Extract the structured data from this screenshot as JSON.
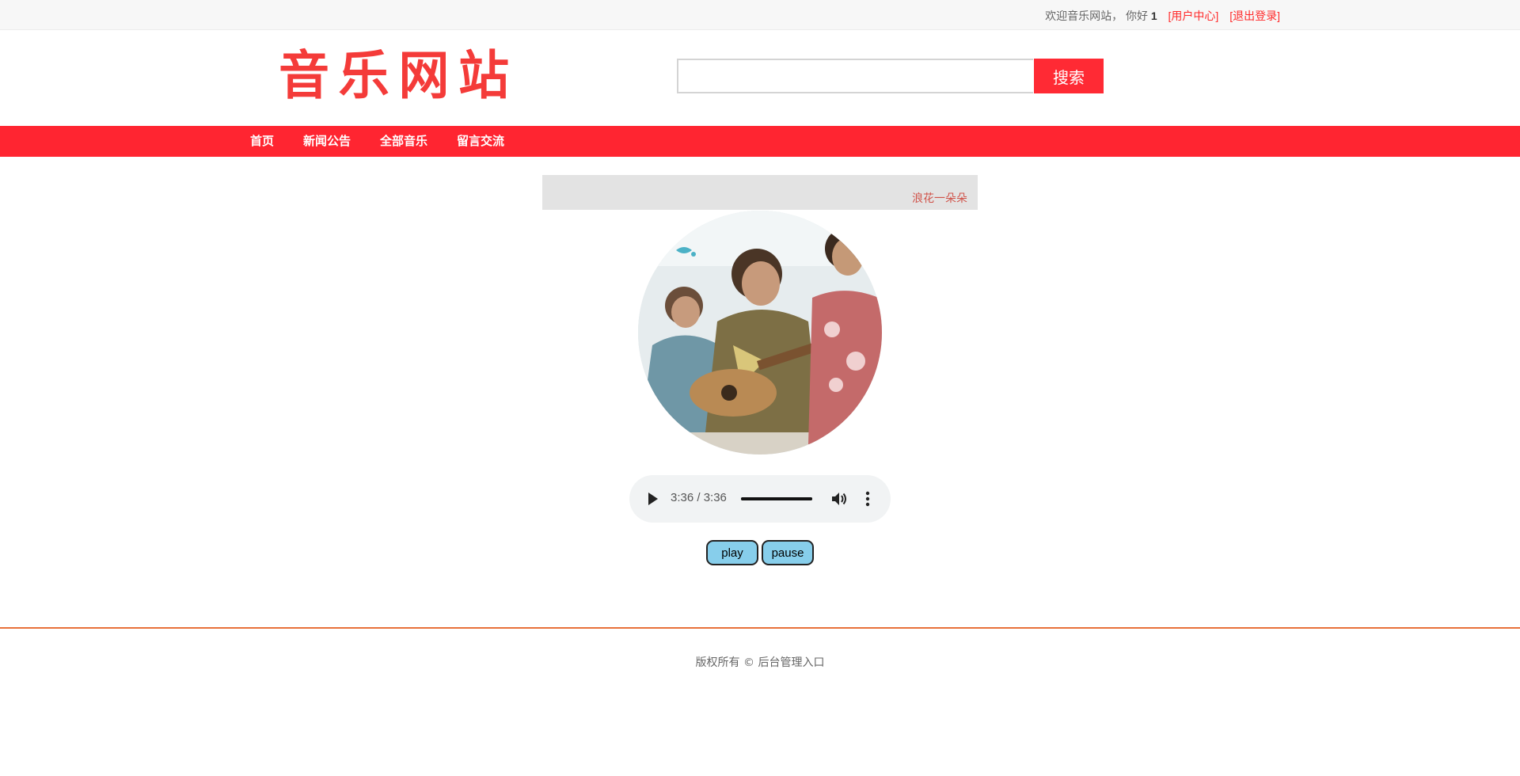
{
  "topbar": {
    "welcome_text": "欢迎音乐网站，  你好",
    "username": "1",
    "user_center_link": "[用户中心]",
    "logout_link": "[退出登录]"
  },
  "header": {
    "logo_text": "音乐网站",
    "search": {
      "value": "",
      "placeholder": "",
      "button_label": "搜索"
    }
  },
  "nav": {
    "items": [
      {
        "label": "首页"
      },
      {
        "label": "新闻公告"
      },
      {
        "label": "全部音乐"
      },
      {
        "label": "留言交流"
      }
    ]
  },
  "song": {
    "title": "浪花一朵朵",
    "player": {
      "current_time": "3:36",
      "duration": "3:36",
      "time_display": "3:36 / 3:36",
      "progress": 1.0
    },
    "buttons": {
      "play_label": "play",
      "pause_label": "pause"
    }
  },
  "footer": {
    "copyright": "版权所有 © 后台管理入口"
  },
  "colors": {
    "brand_red": "#ff2531",
    "logo_red": "#f43b39",
    "link_red": "#ff2a2a",
    "button_blue": "#87ceeb",
    "footer_line": "#e8703a"
  }
}
